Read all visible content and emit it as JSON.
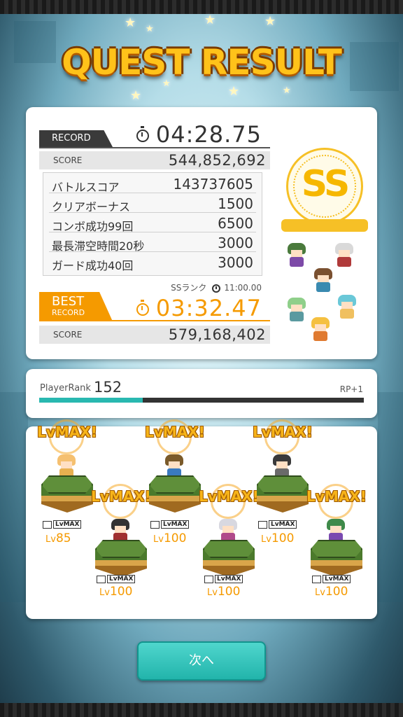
{
  "title": "QUEST RESULT",
  "record": {
    "tag": "RECORD",
    "time": "04:28.75",
    "score_label": "SCORE",
    "score": "544,852,692",
    "breakdown": [
      {
        "label": "バトルスコア",
        "value": "143737605"
      },
      {
        "label": "クリアボーナス",
        "value": "1500"
      },
      {
        "label": "コンボ成功99回",
        "value": "6500"
      },
      {
        "label": "最長滞空時間20秒",
        "value": "3000"
      },
      {
        "label": "ガード成功40回",
        "value": "3000"
      }
    ],
    "ss_condition_label": "SSランク",
    "ss_condition_time": "11:00.00"
  },
  "best": {
    "tag_line1": "BEST",
    "tag_line2": "RECORD",
    "time": "03:32.47",
    "score_label": "SCORE",
    "score": "579,168,402"
  },
  "rank_badge": "SS",
  "player": {
    "label": "PlayerRank",
    "rank": "152",
    "rp": "RP+1",
    "progress": 0.32
  },
  "party": [
    {
      "lvmax": "LvMAX!",
      "badge": "LvMAX",
      "lv_prefix": "Lv",
      "lv": "85"
    },
    {
      "lvmax": "LvMAX!",
      "badge": "LvMAX",
      "lv_prefix": "Lv",
      "lv": "100"
    },
    {
      "lvmax": "LvMAX!",
      "badge": "LvMAX",
      "lv_prefix": "Lv",
      "lv": "100"
    },
    {
      "lvmax": "LvMAX!",
      "badge": "LvMAX",
      "lv_prefix": "Lv",
      "lv": "100"
    },
    {
      "lvmax": "LvMAX!",
      "badge": "LvMAX",
      "lv_prefix": "Lv",
      "lv": "100"
    },
    {
      "lvmax": "LvMAX!",
      "badge": "LvMAX",
      "lv_prefix": "Lv",
      "lv": "100"
    }
  ],
  "next_button": "次へ",
  "colors": {
    "accent": "#f59a00",
    "teal": "#29b8b0",
    "gold": "#f6c026"
  }
}
